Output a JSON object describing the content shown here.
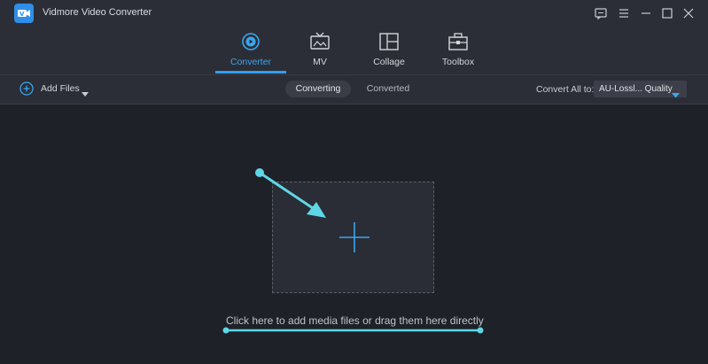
{
  "app": {
    "title": "Vidmore Video Converter"
  },
  "nav": {
    "tabs": [
      {
        "label": "Converter",
        "icon": "converter-icon",
        "active": true
      },
      {
        "label": "MV",
        "icon": "mv-icon"
      },
      {
        "label": "Collage",
        "icon": "collage-icon"
      },
      {
        "label": "Toolbox",
        "icon": "toolbox-icon"
      }
    ]
  },
  "toolbar": {
    "add_files_label": "Add Files",
    "segments": [
      "Converting",
      "Converted"
    ],
    "convert_all_label": "Convert All to:",
    "format_value": "AU-Lossl... Quality"
  },
  "main": {
    "hint": "Click here to add media files or drag them here directly"
  },
  "colors": {
    "accent": "#2f9ef0",
    "annotation": "#5fd6e6",
    "background": "#1f2128",
    "panel": "#2b2e36"
  }
}
